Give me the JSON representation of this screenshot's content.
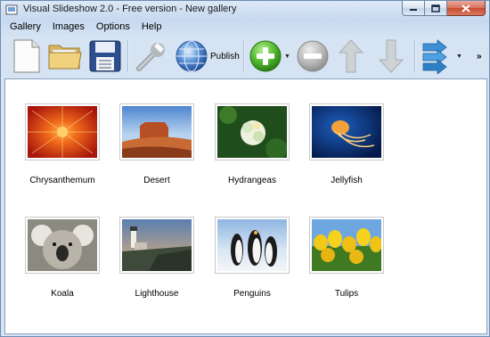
{
  "window": {
    "title": "Visual Slideshow 2.0 - Free version - New gallery"
  },
  "menu": [
    {
      "label": "Gallery"
    },
    {
      "label": "Images"
    },
    {
      "label": "Options"
    },
    {
      "label": "Help"
    }
  ],
  "toolbar": {
    "publish_label": "Publish"
  },
  "gallery": {
    "items": [
      {
        "caption": "Chrysanthemum"
      },
      {
        "caption": "Desert"
      },
      {
        "caption": "Hydrangeas"
      },
      {
        "caption": "Jellyfish"
      },
      {
        "caption": "Koala"
      },
      {
        "caption": "Lighthouse"
      },
      {
        "caption": "Penguins"
      },
      {
        "caption": "Tulips"
      }
    ]
  }
}
